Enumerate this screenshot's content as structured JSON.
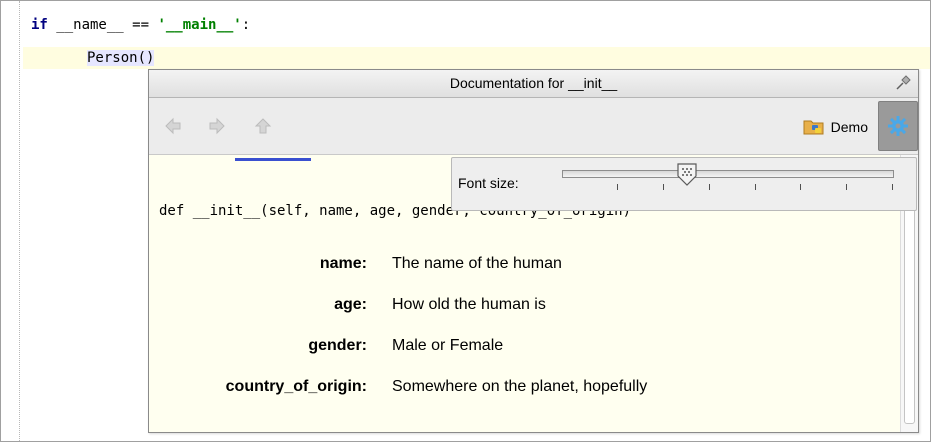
{
  "editor": {
    "line1": {
      "kw_if": "if",
      "name_var": " __name__ == ",
      "string": "'__main__'",
      "colon": ":"
    },
    "line2": {
      "call": "Person()"
    }
  },
  "doc_popup": {
    "title": "Documentation for __init__",
    "toolbar": {
      "back_icon": "back-arrow-icon",
      "forward_icon": "forward-arrow-icon",
      "up_icon": "up-arrow-icon",
      "demo_label": "Demo",
      "settings_icon": "gear-icon"
    },
    "font_size": {
      "label": "Font size:",
      "level": 0.38
    },
    "signature": "def __init__(self, name, age, gender, country_of_origin)",
    "params": [
      {
        "name": "name:",
        "desc": "The name of the human"
      },
      {
        "name": "age:",
        "desc": "How old the human is"
      },
      {
        "name": "gender:",
        "desc": "Male or Female"
      },
      {
        "name": "country_of_origin:",
        "desc": "Somewhere on the planet, hopefully"
      }
    ]
  },
  "colors": {
    "keyword": "#000080",
    "string": "#008000",
    "highlight_line": "#fffde0",
    "popup_bg": "#fffff0"
  }
}
